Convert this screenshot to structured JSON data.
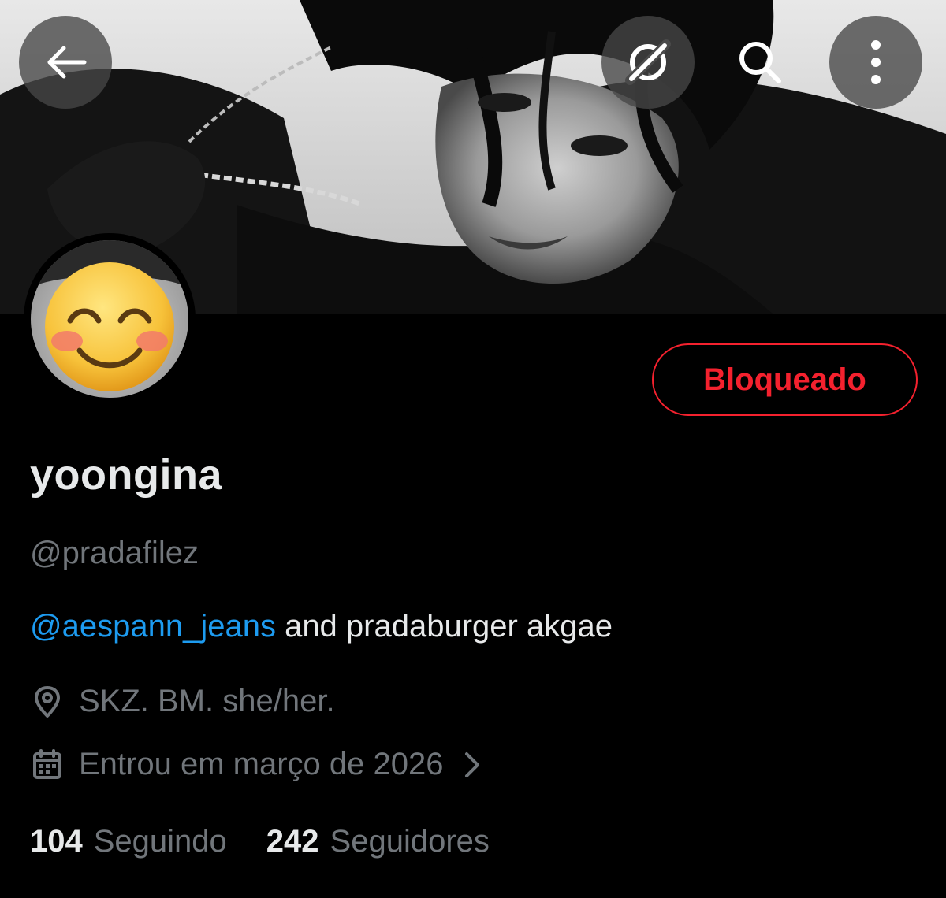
{
  "header": {
    "back_icon": "arrow-left-icon",
    "translate_icon": "grok-slash-icon",
    "search_icon": "search-icon",
    "more_icon": "more-vertical-icon"
  },
  "profile": {
    "display_name": "yoongina",
    "handle": "@pradafilez",
    "bio_mention": "@aespann_jeans",
    "bio_rest": " and pradaburger akgae",
    "location": "SKZ.  BM.  she/her.",
    "joined": "Entrou em março de 2026",
    "blocked_label": "Bloqueado"
  },
  "stats": {
    "following_count": "104",
    "following_label": "Seguindo",
    "followers_count": "242",
    "followers_label": "Seguidores"
  },
  "colors": {
    "background": "#000000",
    "primary_text": "#e7e9ea",
    "secondary_text": "#71767b",
    "mention": "#1d9bf0",
    "blocked": "#f4212e"
  }
}
